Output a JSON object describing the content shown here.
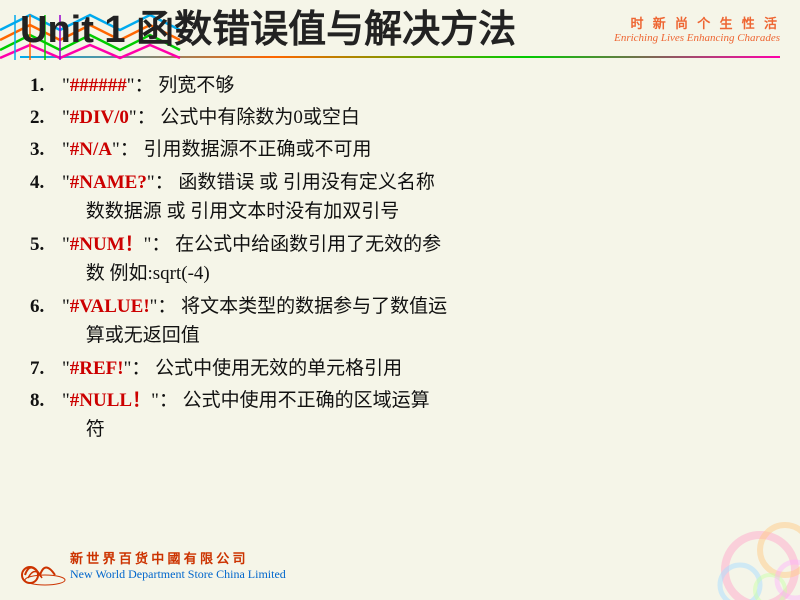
{
  "page": {
    "background_color": "#f5f5e8"
  },
  "header": {
    "title": "Unit 1 函数错误值与解决方法",
    "brand_tagline_cn": "时 新 尚 个 生 性 活",
    "brand_tagline_en": "Enriching Lives Enhancing Charades"
  },
  "items": [
    {
      "num": "1.",
      "error_code": "\"######\"",
      "description": "：  列宽不够"
    },
    {
      "num": "2.",
      "error_code": "\"#DIV/0\"",
      "description": "：  公式中有除数为0或空白"
    },
    {
      "num": "3.",
      "error_code": "\"#N/A\"",
      "description": "：  引用数据源不正确或不可用"
    },
    {
      "num": "4.",
      "error_code": "\"#NAME?\"",
      "description": "：  函数错误 或 引用没有定义名称数数据源 或 引用文本时没有加双引号"
    },
    {
      "num": "5.",
      "error_code": "\"#NUM！\"",
      "description": "：  在公式中给函数引用了无效的参数  例如:sqrt(-4)"
    },
    {
      "num": "6.",
      "error_code": "\"#VALUE!\"",
      "description": "：  将文本类型的数据参与了数值运算或无返回值"
    },
    {
      "num": "7.",
      "error_code": "\"#REF!\"",
      "description": "：  公式中使用无效的单元格引用"
    },
    {
      "num": "8.",
      "error_code": "\"#NULL！\"",
      "description": "：  公式中使用不正确的区域运算符"
    }
  ],
  "company": {
    "cn": "新 世 界 百 货 中 國 有 限 公 司",
    "en": "New World Department Store China Limited"
  }
}
